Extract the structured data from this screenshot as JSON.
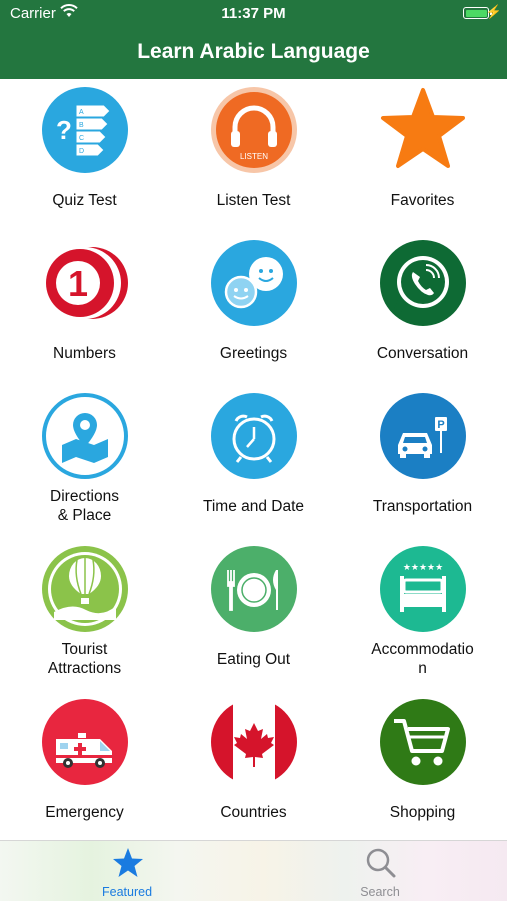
{
  "status_bar": {
    "carrier": "Carrier",
    "time": "11:37 PM"
  },
  "header": {
    "title": "Learn Arabic Language"
  },
  "grid": {
    "items": [
      {
        "label": "Quiz Test",
        "icon": "quiz-icon"
      },
      {
        "label": "Listen Test",
        "icon": "headphones-icon",
        "badge": "LISTEN"
      },
      {
        "label": "Favorites",
        "icon": "star-icon"
      },
      {
        "label": "Numbers",
        "icon": "number-one-icon"
      },
      {
        "label": "Greetings",
        "icon": "smiley-chat-icon"
      },
      {
        "label": "Conversation",
        "icon": "phone-chat-icon"
      },
      {
        "label": "Directions",
        "label_line2": "& Place",
        "icon": "map-pin-icon"
      },
      {
        "label": "Time and Date",
        "icon": "alarm-clock-icon"
      },
      {
        "label": "Transportation",
        "icon": "car-parking-icon"
      },
      {
        "label": "Tourist",
        "label_line2": "Attractions",
        "icon": "hot-air-balloon-icon"
      },
      {
        "label": "Eating Out",
        "icon": "plate-cutlery-icon"
      },
      {
        "label": "Accommodatio",
        "label_line2": "n",
        "icon": "hotel-bed-icon"
      },
      {
        "label": "Emergency",
        "icon": "ambulance-icon"
      },
      {
        "label": "Countries",
        "icon": "canada-flag-icon"
      },
      {
        "label": "Shopping",
        "icon": "shopping-cart-icon"
      }
    ]
  },
  "tabbar": {
    "tabs": [
      {
        "label": "Featured",
        "icon": "star-icon",
        "active": true
      },
      {
        "label": "Search",
        "icon": "search-icon",
        "active": false
      }
    ]
  },
  "colors": {
    "header": "#23763f",
    "active_tab": "#1a7be0",
    "inactive_tab": "#8e8e93"
  }
}
